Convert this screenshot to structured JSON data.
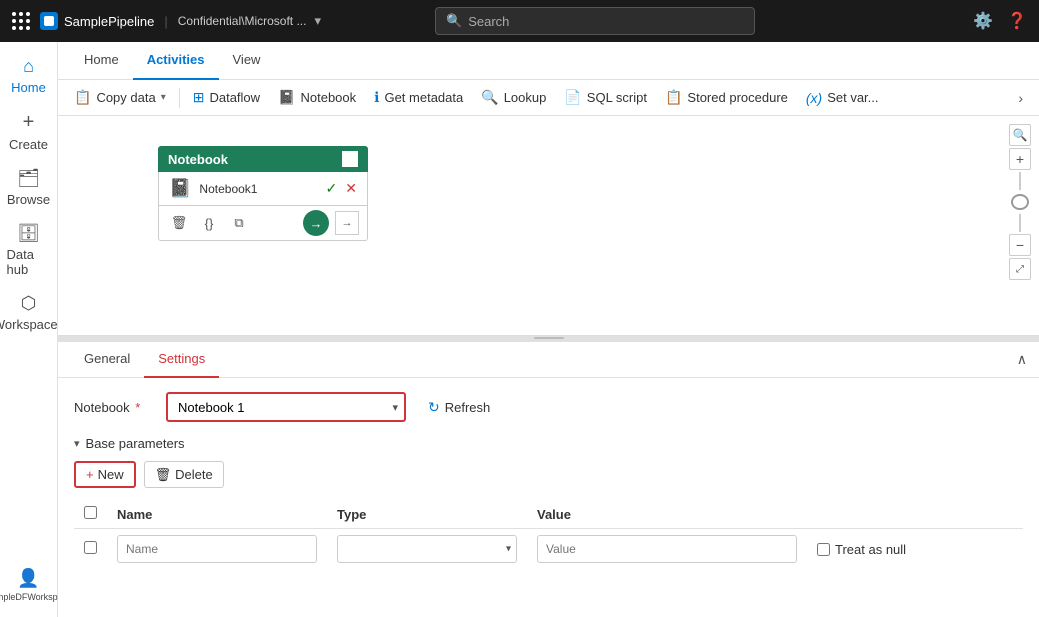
{
  "topbar": {
    "pipeline_name": "SamplePipeline",
    "workspace_label": "Confidential\\Microsoft ...",
    "search_placeholder": "Search",
    "settings_label": "Settings",
    "help_label": "Help"
  },
  "sidebar": {
    "items": [
      {
        "id": "home",
        "label": "Home",
        "icon": "⌂"
      },
      {
        "id": "create",
        "label": "Create",
        "icon": "＋"
      },
      {
        "id": "browse",
        "label": "Browse",
        "icon": "📁"
      },
      {
        "id": "data-hub",
        "label": "Data hub",
        "icon": "💾"
      },
      {
        "id": "workspaces",
        "label": "Workspaces",
        "icon": "⬡"
      }
    ],
    "bottom_item": {
      "id": "sample-workspace",
      "label": "SampleDFWorkspace",
      "icon": "👤"
    }
  },
  "nav_tabs": [
    {
      "id": "home",
      "label": "Home",
      "active": false
    },
    {
      "id": "activities",
      "label": "Activities",
      "active": true
    },
    {
      "id": "view",
      "label": "View",
      "active": false
    }
  ],
  "toolbar": {
    "items": [
      {
        "id": "copy-data",
        "label": "Copy data",
        "icon": "📋",
        "has_chevron": true
      },
      {
        "id": "dataflow",
        "label": "Dataflow",
        "icon": "🔀",
        "has_chevron": false
      },
      {
        "id": "notebook",
        "label": "Notebook",
        "icon": "📓",
        "has_chevron": false
      },
      {
        "id": "get-metadata",
        "label": "Get metadata",
        "icon": "ℹ",
        "has_chevron": false
      },
      {
        "id": "lookup",
        "label": "Lookup",
        "icon": "🔍",
        "has_chevron": false
      },
      {
        "id": "sql-script",
        "label": "SQL script",
        "icon": "📄",
        "has_chevron": false
      },
      {
        "id": "stored-procedure",
        "label": "Stored procedure",
        "icon": "📋",
        "has_chevron": false
      },
      {
        "id": "set-variable",
        "label": "Set var...",
        "icon": "(x)",
        "has_chevron": false
      }
    ]
  },
  "canvas": {
    "node": {
      "title": "Notebook",
      "name": "Notebook1",
      "status_ok": true,
      "status_err": true
    }
  },
  "bottom_panel": {
    "tabs": [
      {
        "id": "general",
        "label": "General",
        "active": false
      },
      {
        "id": "settings",
        "label": "Settings",
        "active": true
      }
    ],
    "notebook_label": "Notebook",
    "notebook_required": true,
    "notebook_value": "Notebook 1",
    "refresh_label": "Refresh",
    "base_params_label": "Base parameters",
    "new_label": "+ New",
    "delete_label": "Delete",
    "table_headers": {
      "checkbox": "",
      "name": "Name",
      "type": "Type",
      "value": "Value"
    },
    "table_row": {
      "name_placeholder": "Name",
      "type_placeholder": "",
      "value_placeholder": "Value",
      "treat_null_label": "Treat as null"
    }
  }
}
